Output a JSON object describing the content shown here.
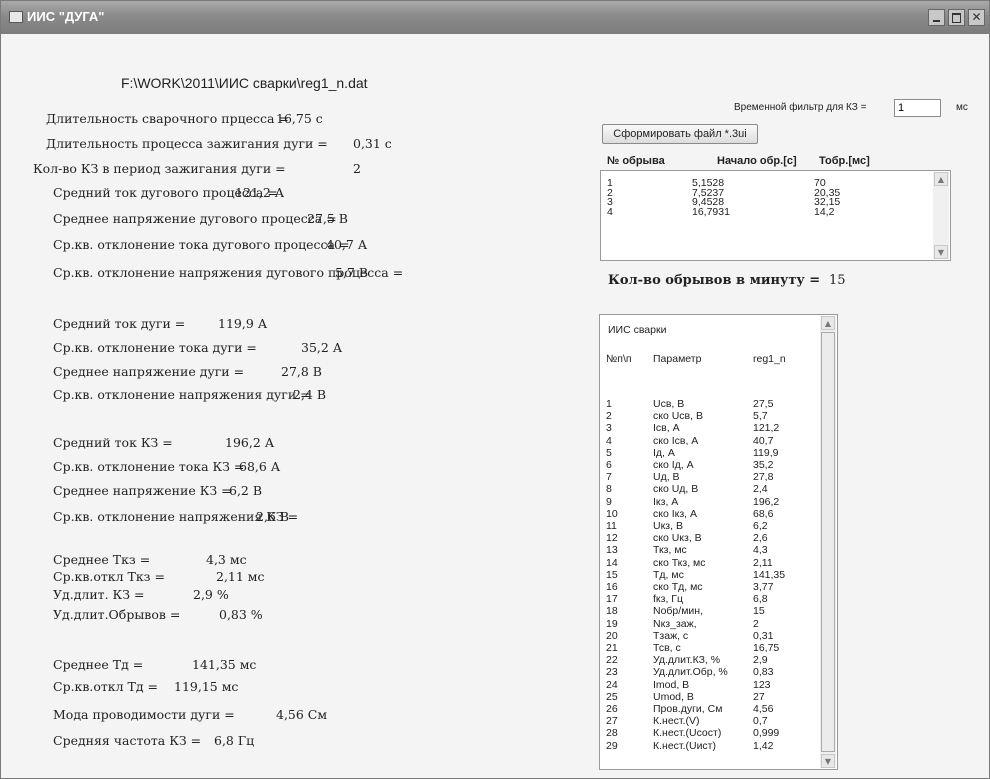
{
  "window": {
    "title": "ИИС \"ДУГА\""
  },
  "file_path": "F:\\WORK\\2011\\ИИС сварки\\reg1_n.dat",
  "stats": [
    {
      "label": "Длительность сварочного прцесса =",
      "value": "16,75 с"
    },
    {
      "label": "Длительность процесса зажигания дуги =",
      "value": "0,31 с"
    },
    {
      "label": "Кол-во КЗ в период зажигания дуги =",
      "value": "2"
    },
    {
      "label": "Средний ток дугового процесса =",
      "value": "121,2 А"
    },
    {
      "label": "Среднее напряжение дугового процесса =",
      "value": "27,5 В"
    },
    {
      "label": "Ср.кв. отклонение тока дугового процесса =",
      "value": "40,7 А"
    },
    {
      "label": "Ср.кв. отклонение напряжения дугового процесса =",
      "value": "5,7 В"
    },
    {
      "label": "Средний ток дуги =",
      "value": "119,9 А"
    },
    {
      "label": "Ср.кв.  отклонение тока дуги =",
      "value": "35,2 А"
    },
    {
      "label": "Среднее напряжение дуги =",
      "value": "27,8 В"
    },
    {
      "label": "Ср.кв. отклонение напряжения дуги =",
      "value": "2,4 В"
    },
    {
      "label": "Средний ток КЗ =",
      "value": "196,2 А"
    },
    {
      "label": "Ср.кв. отклонение тока КЗ =",
      "value": "68,6 А"
    },
    {
      "label": "Среднее напряжение КЗ =",
      "value": "6,2 В"
    },
    {
      "label": "Ср.кв. отклонение напряжения КЗ =",
      "value": "2,6 В"
    },
    {
      "label": "Среднее Ткз =",
      "value": "4,3  мс"
    },
    {
      "label": "Ср.кв.откл Ткз =",
      "value": "2,11  мс"
    },
    {
      "label": "Уд.длит. КЗ =",
      "value": "2,9 %"
    },
    {
      "label": "Уд.длит.Обрывов =",
      "value": "0,83 %"
    },
    {
      "label": "Среднее Тд =",
      "value": "141,35  мс"
    },
    {
      "label": "Ср.кв.откл Тд =",
      "value": "119,15  мс"
    },
    {
      "label": "Мода проводимости дуги =",
      "value": "4,56   См"
    },
    {
      "label": "Средняя частота КЗ =",
      "value": "6,8 Гц"
    }
  ],
  "filter": {
    "label": "Временной фильтр для КЗ =",
    "value": "1",
    "unit": "мс"
  },
  "generate_button": "Сформировать файл *.3ui",
  "breaks": {
    "headers": [
      "№ обрыва",
      "Начало обр.[с]",
      "Тобр.[мс]"
    ],
    "rows": [
      [
        "1",
        "5,1528",
        "70"
      ],
      [
        "2",
        "7,5237",
        "20,35"
      ],
      [
        "3",
        "9,4528",
        "32,15"
      ],
      [
        "4",
        "16,7931",
        "14,2"
      ]
    ]
  },
  "breaks_per_minute": {
    "label": "Кол-во обрывов в минуту =",
    "value": "15"
  },
  "params": {
    "title": "ИИС сварки",
    "headers": [
      "№п\\п",
      "Параметр",
      "reg1_n"
    ],
    "rows": [
      [
        "1",
        "Uсв, В",
        "27,5"
      ],
      [
        "2",
        "ско Uсв, В",
        "5,7"
      ],
      [
        "3",
        "Iсв, А",
        "121,2"
      ],
      [
        "4",
        "ско Iсв, А",
        "40,7"
      ],
      [
        "5",
        "Iд, А",
        "119,9"
      ],
      [
        "6",
        "ско Iд, А",
        "35,2"
      ],
      [
        "7",
        "Uд, В",
        "27,8"
      ],
      [
        "8",
        "ско Uд, В",
        "2,4"
      ],
      [
        "9",
        "Iкз, А",
        "196,2"
      ],
      [
        "10",
        "ско Iкз, А",
        "68,6"
      ],
      [
        "11",
        "Uкз, В",
        "6,2"
      ],
      [
        "12",
        "ско Uкз, В",
        "2,6"
      ],
      [
        "13",
        "Ткз, мс",
        "4,3"
      ],
      [
        "14",
        "ско Ткз, мс",
        "2,11"
      ],
      [
        "15",
        "Тд, мс",
        "141,35"
      ],
      [
        "16",
        "ско Тд, мс",
        "3,77"
      ],
      [
        "17",
        "fкз, Гц",
        "6,8"
      ],
      [
        "18",
        "Nобр/мин,",
        "15"
      ],
      [
        "19",
        "Nкз_заж,",
        "2"
      ],
      [
        "20",
        "Тзаж, с",
        "0,31"
      ],
      [
        "21",
        "Тсв, с",
        "16,75"
      ],
      [
        "22",
        "Уд.длит.КЗ, %",
        "2,9"
      ],
      [
        "23",
        "Уд.длит.Обр, %",
        "0,83"
      ],
      [
        "24",
        "Imod, В",
        "123"
      ],
      [
        "25",
        "Umod, В",
        "27"
      ],
      [
        "26",
        "Пров.дуги, См",
        "4,56"
      ],
      [
        "27",
        "К.нест.(V)",
        "0,7"
      ],
      [
        "28",
        "К.нест.(Uсост)",
        "0,999"
      ],
      [
        "29",
        "К.нест.(Uист)",
        "1,42"
      ]
    ]
  }
}
